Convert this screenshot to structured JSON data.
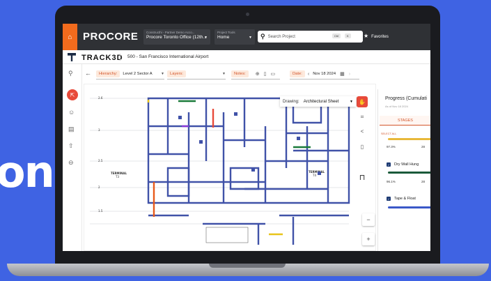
{
  "background_text": "on",
  "topbar": {
    "logo": "PROCORE",
    "company_small": "Constructhi - Partner Demo Acco...",
    "company_name": "Procore Toronto Office (12th...",
    "tools_small": "Project Tools",
    "tools_value": "Home",
    "search_placeholder": "Search Project",
    "kbd_ctrl": "Ctrl",
    "kbd_k": "K",
    "favorites": "Favorites"
  },
  "subheader": {
    "app_name": "TRACK3D",
    "project": "500 - San Francisco International Airport"
  },
  "toolbar": {
    "hierarchy_label": "Hierarchy:",
    "hierarchy_value": "Level 2 Sector A",
    "layers_label": "Layers:",
    "notes_label": "Notes:",
    "date_label": "Date:",
    "date_value": "Nov 18 2024"
  },
  "drawing": {
    "label": "Drawing:",
    "value": "Architectural Sheet",
    "terminal_left": "TERMINAL",
    "terminal_left_num": "T3",
    "terminal_right": "TERMINAL",
    "terminal_right_num": "T4",
    "grid_26": "2.6",
    "grid_3": "3",
    "grid_25": "2.5",
    "grid_2": "2",
    "grid_15": "1.5"
  },
  "panel": {
    "title": "Progress (Cumulati",
    "date": "As of Nov 18 2024",
    "tab": "STAGES",
    "select_all": "SELECT ALL",
    "items": [
      {
        "pct": "97.3%",
        "pct2": "28"
      },
      {
        "label": "Dry Wall Hung",
        "pct": "96.1%",
        "pct2": "28"
      },
      {
        "label": "Tape & Float"
      }
    ]
  },
  "colors": {
    "brand": "#f26b1d",
    "accent": "#d3552a",
    "wall": "#4052a8",
    "bg": "#3f63e3"
  }
}
